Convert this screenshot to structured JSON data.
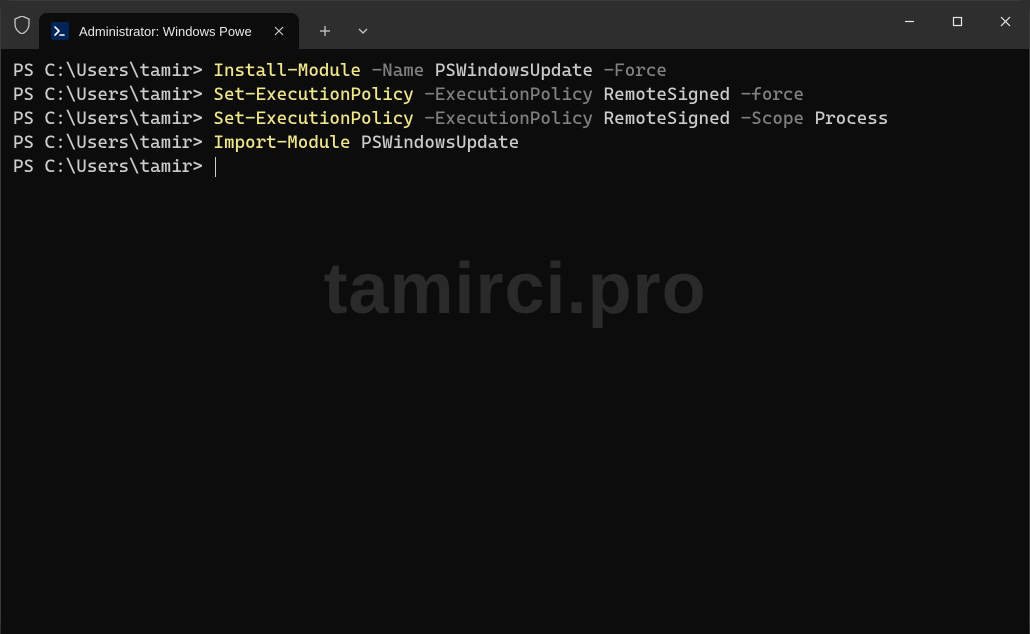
{
  "tab": {
    "title": "Administrator: Windows Powe"
  },
  "watermark": "tamirci.pro",
  "terminal": {
    "lines": [
      {
        "prompt": "PS C:\\Users\\tamir> ",
        "segments": [
          {
            "cls": "cmd",
            "text": "Install-Module"
          },
          {
            "cls": "param",
            "text": " -Name "
          },
          {
            "cls": "arg",
            "text": "PSWindowsUpdate"
          },
          {
            "cls": "param",
            "text": " -Force"
          }
        ]
      },
      {
        "prompt": "PS C:\\Users\\tamir> ",
        "segments": [
          {
            "cls": "cmd",
            "text": "Set-ExecutionPolicy"
          },
          {
            "cls": "param",
            "text": " -ExecutionPolicy "
          },
          {
            "cls": "arg",
            "text": "RemoteSigned"
          },
          {
            "cls": "param",
            "text": " -force"
          }
        ]
      },
      {
        "prompt": "PS C:\\Users\\tamir> ",
        "segments": [
          {
            "cls": "cmd",
            "text": "Set-ExecutionPolicy"
          },
          {
            "cls": "param",
            "text": " -ExecutionPolicy "
          },
          {
            "cls": "arg",
            "text": "RemoteSigned"
          },
          {
            "cls": "param",
            "text": " -Scope "
          },
          {
            "cls": "arg",
            "text": "Process"
          }
        ]
      },
      {
        "prompt": "PS C:\\Users\\tamir> ",
        "segments": [
          {
            "cls": "cmd",
            "text": "Import-Module"
          },
          {
            "cls": "arg",
            "text": " PSWindowsUpdate"
          }
        ]
      },
      {
        "prompt": "PS C:\\Users\\tamir> ",
        "segments": [],
        "cursor": true
      }
    ]
  }
}
